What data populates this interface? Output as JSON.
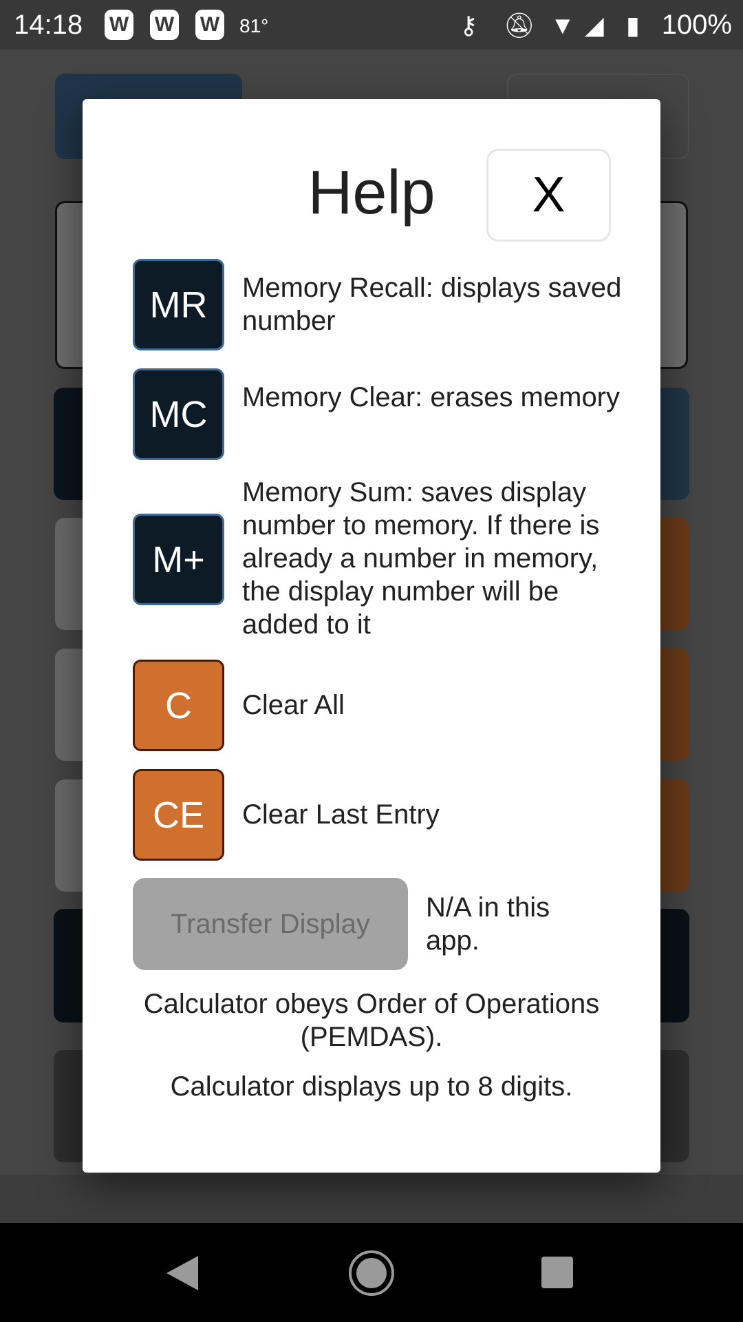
{
  "status_bar": {
    "time": "14:18",
    "notifications": [
      "W",
      "W",
      "W"
    ],
    "temperature": "81°",
    "icons": [
      "vpn-key-icon",
      "bell-off-icon",
      "wifi-icon",
      "signal-icon",
      "battery-charging-icon"
    ],
    "battery": "100%"
  },
  "dialog": {
    "title": "Help",
    "close_label": "X",
    "items": [
      {
        "key": "MR",
        "description": "Memory Recall: displays saved number",
        "color": "#0d1b26"
      },
      {
        "key": "MC",
        "description": "Memory Clear: erases memory",
        "color": "#0d1b26"
      },
      {
        "key": "M+",
        "description": "Memory Sum: saves display number to memory. If there is already a number in memory, the display number will be added to it",
        "color": "#0d1b26"
      },
      {
        "key": "C",
        "description": "Clear All",
        "color": "#d0702e"
      },
      {
        "key": "CE",
        "description": "Clear Last Entry",
        "color": "#d0702e"
      }
    ],
    "transfer": {
      "label": "Transfer Display",
      "description": "N/A in this app."
    },
    "notes": [
      "Calculator obeys Order of Operations (PEMDAS).",
      "Calculator displays up to 8 digits."
    ]
  }
}
